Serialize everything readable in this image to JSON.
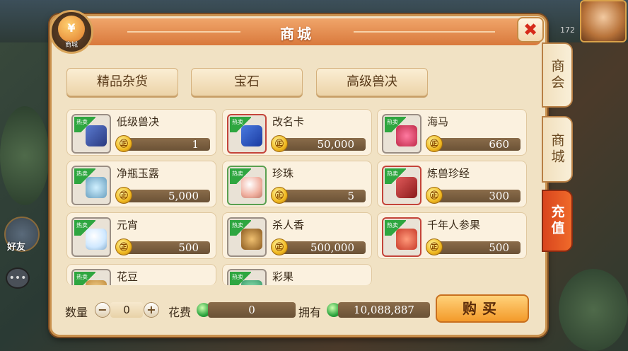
{
  "hud": {
    "number": "172"
  },
  "side": {
    "friend_label": "好友"
  },
  "shop": {
    "title": "商城",
    "badge_label": "商城",
    "badge_symbol": "¥",
    "close_symbol": "✖",
    "side_tabs": [
      "商会",
      "商城",
      "充值"
    ],
    "active_side_tab": "商城",
    "categories": [
      "精品杂货",
      "宝石",
      "高级兽决"
    ],
    "hot_tag": "热卖",
    "coin_symbol": "㊣",
    "items": [
      {
        "name": "低级兽决",
        "price": "1",
        "icon": "book-icon",
        "frame": "gray"
      },
      {
        "name": "改名卡",
        "price": "50,000",
        "icon": "card-icon",
        "frame": "red"
      },
      {
        "name": "海马",
        "price": "660",
        "icon": "seahorse-icon",
        "frame": "gray"
      },
      {
        "name": "净瓶玉露",
        "price": "5,000",
        "icon": "vase-icon",
        "frame": "gray"
      },
      {
        "name": "珍珠",
        "price": "5",
        "icon": "pearl-icon",
        "frame": "green"
      },
      {
        "name": "炼兽珍经",
        "price": "300",
        "icon": "scripture-icon",
        "frame": "red"
      },
      {
        "name": "元宵",
        "price": "500",
        "icon": "rice-ball-icon",
        "frame": "gray"
      },
      {
        "name": "杀人香",
        "price": "500,000",
        "icon": "incense-icon",
        "frame": "gray"
      },
      {
        "name": "千年人参果",
        "price": "500",
        "icon": "ginseng-fruit-icon",
        "frame": "red"
      },
      {
        "name": "花豆",
        "price": "",
        "icon": "bean-icon",
        "frame": "gray"
      },
      {
        "name": "彩果",
        "price": "",
        "icon": "color-fruit-icon",
        "frame": "gray"
      }
    ],
    "quantity_label": "数量",
    "quantity_value": "0",
    "minus_symbol": "−",
    "plus_symbol": "+",
    "cost_label": "花费",
    "cost_value": "0",
    "owned_label": "拥有",
    "owned_value": "10,088,887",
    "buy_label": "购买"
  }
}
